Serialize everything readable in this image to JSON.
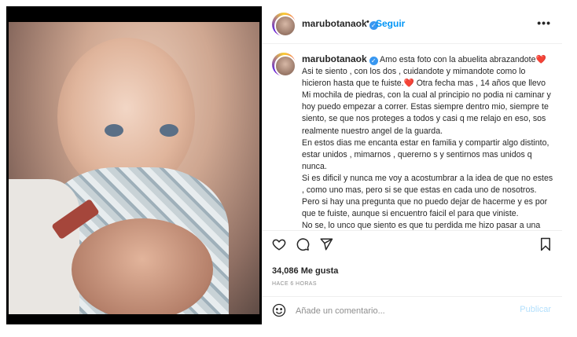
{
  "post": {
    "username": "marubotanaok",
    "follow_label": "Seguir",
    "dot": "•",
    "more_label": "•••"
  },
  "caption": {
    "username": "marubotanaok",
    "paragraphs": [
      "Amo esta foto con la abuelita abrazandote❤️ Asi te siento , con los dos , cuidandote y mimandote como lo hicieron hasta que te fuiste.❤️ Otra fecha mas , 14 años que llevo Mi mochila de piedras, con la cual al principio no podia ni caminar y hoy puedo empezar a correr. Estas siempre dentro mio, siempre te siento, se que nos proteges a todos y casi q me relajo en eso, sos realmente nuestro angel de la guarda.",
      "En estos dias me encanta estar en familia y compartir algo distinto, estar unidos , mimarnos , quererno s y sentirnos mas unidos q nunca.",
      "Si es dificil y nunca me voy a acostumbrar a la idea de que no estes , como uno mas, pero si se que estas en cada uno de nosotros.",
      "Pero si hay una pregunta que no puedo dejar de hacerme y es por que te fuiste, aunque si encuentro faicil el para que viniste.",
      "No se, lo unco que siento es que tu perdida me hizo pasar a una"
    ]
  },
  "icons": [
    "heart-icon",
    "comment-icon",
    "share-icon",
    "bookmark-icon",
    "emoji-icon",
    "verified-icon"
  ],
  "stats": {
    "likes": "34,086 Me gusta",
    "time": "HACE 6 HORAS"
  },
  "comment": {
    "placeholder": "Añade un comentario...",
    "publish_label": "Publicar"
  },
  "colors": {
    "accent": "#0095f6",
    "publish_disabled": "#b2dffc",
    "verified": "#3897f0"
  }
}
